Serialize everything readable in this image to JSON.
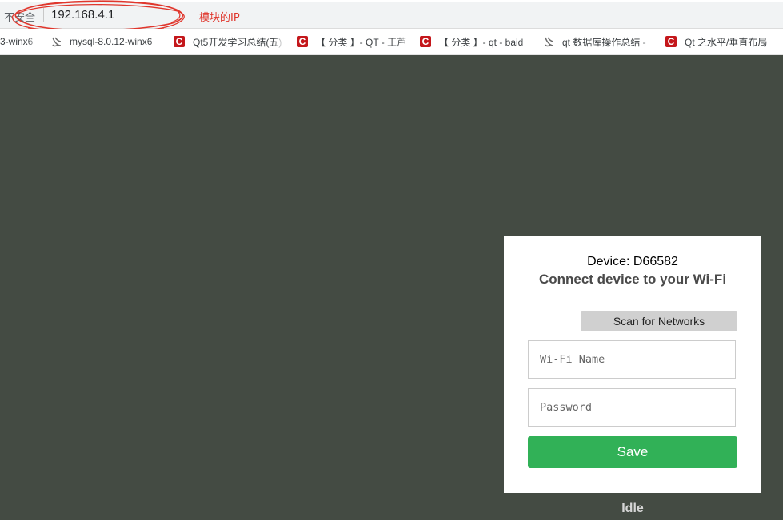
{
  "browser": {
    "security_label": "不安全",
    "url": "192.168.4.1",
    "annotation": "模块的IP",
    "annotation_color": "#e0362c"
  },
  "bookmarks": [
    {
      "icon": "leaf-icon",
      "label": "3-winx6"
    },
    {
      "icon": "leaf-icon",
      "label": "mysql-8.0.12-winx6"
    },
    {
      "icon": "csdn-icon",
      "label": "Qt5开发学习总结(五)"
    },
    {
      "icon": "csdn-icon",
      "label": "【 分类 】- QT - 王芦"
    },
    {
      "icon": "csdn-icon",
      "label": "【 分类 】- qt - baid"
    },
    {
      "icon": "leaf-icon",
      "label": "qt 数据库操作总结 -"
    },
    {
      "icon": "csdn-icon",
      "label": "Qt 之水平/垂直布局"
    }
  ],
  "card": {
    "device_title": "Device: D66582",
    "subtitle": "Connect device to your Wi-Fi",
    "scan_label": "Scan for Networks",
    "wifi_name_placeholder": "Wi-Fi Name",
    "password_placeholder": "Password",
    "save_label": "Save"
  },
  "status": "Idle",
  "colors": {
    "page_background": "#444b43",
    "save_button": "#31b157",
    "scan_button": "#d0d0d0"
  }
}
